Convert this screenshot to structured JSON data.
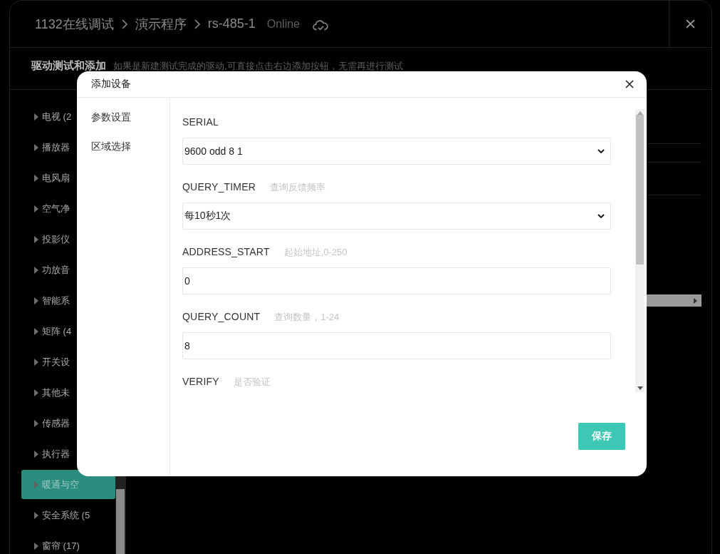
{
  "window": {
    "breadcrumb": [
      "1132在线调试",
      "演示程序",
      "rs-485-1"
    ],
    "status": "Online"
  },
  "section": {
    "title": "驱动测试和添加",
    "description": "如果是新建测试完成的驱动,可直接点击右边添加按钮，无需再进行测试"
  },
  "categories": [
    {
      "label": "电视 (2",
      "selected": false
    },
    {
      "label": "播放器",
      "selected": false
    },
    {
      "label": "电风扇",
      "selected": false
    },
    {
      "label": "空气净",
      "selected": false
    },
    {
      "label": "投影仪",
      "selected": false
    },
    {
      "label": "功放音",
      "selected": false
    },
    {
      "label": "智能系",
      "selected": false
    },
    {
      "label": "矩阵 (4",
      "selected": false
    },
    {
      "label": "开关设",
      "selected": false
    },
    {
      "label": "其他未",
      "selected": false
    },
    {
      "label": "传感器",
      "selected": false
    },
    {
      "label": "执行器",
      "selected": false
    },
    {
      "label": "暖通与空",
      "selected": true
    },
    {
      "label": "安全系统 (5",
      "selected": false
    },
    {
      "label": "窗帘 (17)",
      "selected": false
    }
  ],
  "dialog": {
    "title": "添加设备",
    "nav": [
      "参数设置",
      "区域选择"
    ],
    "fields": [
      {
        "name": "SERIAL",
        "kind": "select",
        "value": "9600 odd 8 1"
      },
      {
        "name": "QUERY_TIMER",
        "hint": "查询反馈频率",
        "kind": "select",
        "value": "每10秒1次"
      },
      {
        "name": "ADDRESS_START",
        "hint": "起始地址,0-250",
        "kind": "input",
        "value": "0"
      },
      {
        "name": "QUERY_COUNT",
        "hint": "查询数量，1-24",
        "kind": "input",
        "value": "8"
      },
      {
        "name": "VERIFY",
        "hint": "是否验证"
      }
    ],
    "save_button": "保存"
  }
}
